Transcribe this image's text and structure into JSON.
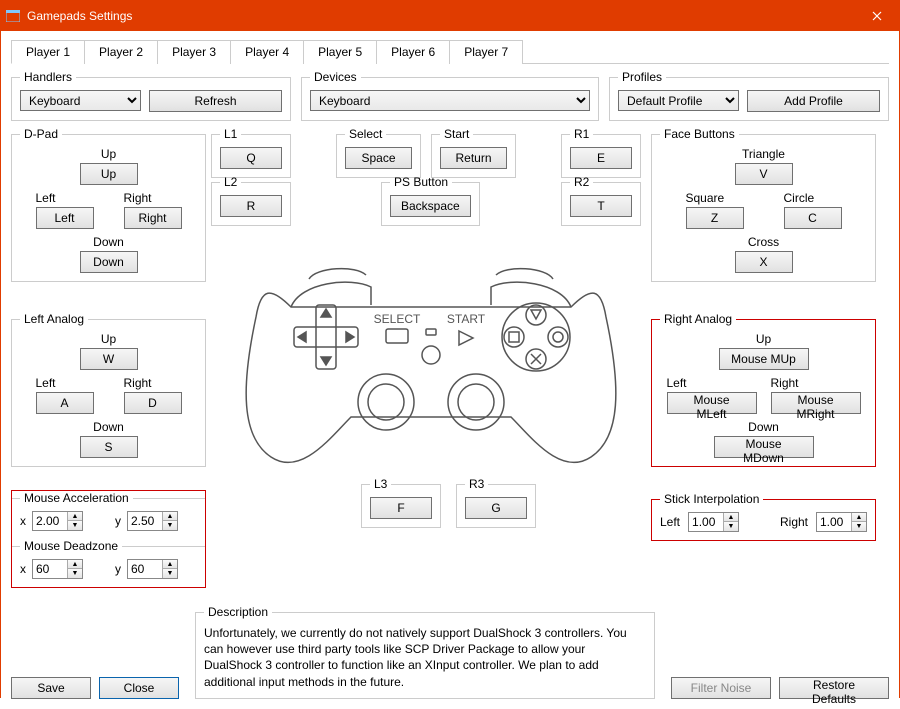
{
  "window": {
    "title": "Gamepads Settings"
  },
  "tabs": [
    "Player 1",
    "Player 2",
    "Player 3",
    "Player 4",
    "Player 5",
    "Player 6",
    "Player 7"
  ],
  "activeTab": 0,
  "handlers": {
    "legend": "Handlers",
    "value": "Keyboard",
    "refresh": "Refresh"
  },
  "devices": {
    "legend": "Devices",
    "value": "Keyboard"
  },
  "profiles": {
    "legend": "Profiles",
    "value": "Default Profile",
    "add": "Add Profile"
  },
  "dpad": {
    "legend": "D-Pad",
    "up_lbl": "Up",
    "up": "Up",
    "left_lbl": "Left",
    "left": "Left",
    "right_lbl": "Right",
    "right": "Right",
    "down_lbl": "Down",
    "down": "Down"
  },
  "l1": {
    "legend": "L1",
    "value": "Q"
  },
  "l2": {
    "legend": "L2",
    "value": "R"
  },
  "select": {
    "legend": "Select",
    "value": "Space"
  },
  "start": {
    "legend": "Start",
    "value": "Return"
  },
  "psbutton": {
    "legend": "PS Button",
    "value": "Backspace"
  },
  "r1": {
    "legend": "R1",
    "value": "E"
  },
  "r2": {
    "legend": "R2",
    "value": "T"
  },
  "face": {
    "legend": "Face Buttons",
    "triangle_lbl": "Triangle",
    "triangle": "V",
    "square_lbl": "Square",
    "square": "Z",
    "circle_lbl": "Circle",
    "circle": "C",
    "cross_lbl": "Cross",
    "cross": "X"
  },
  "leftAnalog": {
    "legend": "Left Analog",
    "up_lbl": "Up",
    "up": "W",
    "left_lbl": "Left",
    "left": "A",
    "right_lbl": "Right",
    "right": "D",
    "down_lbl": "Down",
    "down": "S"
  },
  "rightAnalog": {
    "legend": "Right Analog",
    "up_lbl": "Up",
    "up": "Mouse MUp",
    "left_lbl": "Left",
    "left": "Mouse MLeft",
    "right_lbl": "Right",
    "right": "Mouse MRight",
    "down_lbl": "Down",
    "down": "Mouse MDown"
  },
  "l3": {
    "legend": "L3",
    "value": "F"
  },
  "r3": {
    "legend": "R3",
    "value": "G"
  },
  "mouseAccel": {
    "legend": "Mouse Acceleration",
    "x_lbl": "x",
    "x": "2.00",
    "y_lbl": "y",
    "y": "2.50"
  },
  "mouseDead": {
    "legend": "Mouse Deadzone",
    "x_lbl": "x",
    "x": "60",
    "y_lbl": "y",
    "y": "60"
  },
  "stickInterp": {
    "legend": "Stick Interpolation",
    "left_lbl": "Left",
    "left": "1.00",
    "right_lbl": "Right",
    "right": "1.00"
  },
  "description": {
    "legend": "Description",
    "text": "Unfortunately, we currently do not natively support DualShock 3 controllers. You can however use third party tools like SCP Driver Package to allow your DualShock 3 controller to function like an XInput controller. We plan to add additional input methods in the future."
  },
  "buttons": {
    "save": "Save",
    "close": "Close",
    "filterNoise": "Filter Noise",
    "restoreDefaults": "Restore Defaults"
  }
}
